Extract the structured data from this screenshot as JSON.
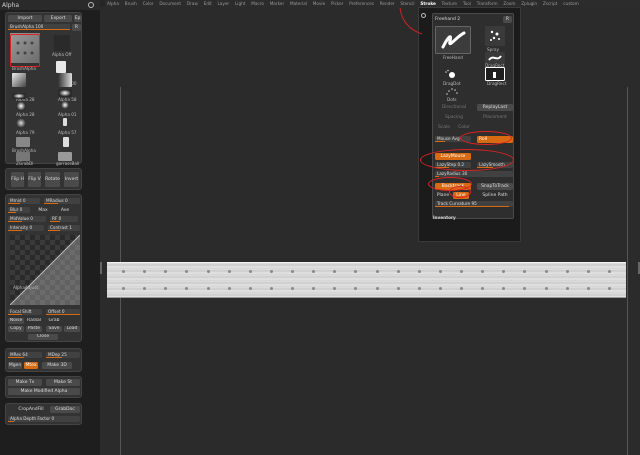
{
  "palette": {
    "title": "Alpha",
    "import_label": "Import",
    "export_label": "Export",
    "ep_label": "Ep",
    "brush_alpha_slider": "BrushAlpha 100",
    "r_label": "R",
    "current_alpha_label": "BrushAlpha",
    "alpha_off_label": "Alpha Off",
    "thumb_labels": [
      "Alpha 00",
      "Alpha 28",
      "Alpha 58",
      "Alpha 28",
      "Alpha 01",
      "Alpha 79",
      "Alpha 57",
      "BrushAlpha",
      "ZGrabDl",
      "garrassBall"
    ],
    "tool_buttons": [
      "Flip H",
      "Flip V",
      "Rotate",
      "Invert"
    ],
    "adjust": {
      "mmid_label": "Mmid 0",
      "mradius_label": "MRadius 0",
      "blur_label": "Blur 0",
      "max_label": "Max",
      "ave_label": "Ave",
      "midvalue_label": "MidValue 0",
      "rf_label": "RF 0",
      "intensity_label": "Intensity 0",
      "contrast_label": "Contrast 1",
      "alpha_adjust_label": "AlphaAdjust",
      "focal_shift_label": "Focal Shift",
      "offset_label": "Offset 0",
      "noise_label": "Noise",
      "radial_label": "Radial",
      "grab_label": "Grab",
      "copy_label": "Copy",
      "paste_label": "Paste",
      "save_label": "Save",
      "load_label": "Load",
      "close_label": "Close"
    },
    "make": {
      "mres_label": "MRes 64",
      "mdep_label": "MDep 25",
      "mgen_label": "Mgen",
      "mtex_label": "Mtex",
      "make3d_label": "Make 3D",
      "maketx_label": "Make Tx",
      "makest_label": "Make St",
      "make_modified_label": "Make Modified Alpha"
    },
    "depth": {
      "cropfill_label": "CropAndFill",
      "grabdoc_label": "GrabDoc",
      "depth_factor_label": "Alpha Depth Factor 0"
    }
  },
  "menubar": {
    "items": [
      "Alpha",
      "Brush",
      "Color",
      "Document",
      "Draw",
      "Edit",
      "Layer",
      "Light",
      "Macro",
      "Marker",
      "Material",
      "Movie",
      "Picker",
      "Preferences",
      "Render",
      "Stencil",
      "Stroke",
      "Texture",
      "Tool",
      "Transform",
      "Zoom",
      "Zplugin",
      "Zscript",
      "custom"
    ]
  },
  "stroke_popup": {
    "type_label": "Freehand 2",
    "r_label": "R",
    "freehand_label": "FreeHand",
    "spray_label": "Spray",
    "colorize_label": "DragRect",
    "dragdot_label": "DragDot",
    "dragrect_label": "DragRect",
    "dots_label": "Dots",
    "directional_label": "Directional",
    "replaylast_label": "ReplayLast",
    "spacing_label": "Spacing",
    "placement_label": "Placement",
    "scale_label": "Scale",
    "color_label": "Color",
    "mouse_avg_label": "Mouse Avg",
    "roll_label": "Roll",
    "lazymouse_label": "LazyMouse",
    "lazystep_label": "LazyStep 0.2",
    "lazysmooth_label": "LazySmooth",
    "lazyradius_label": "LazyRadius 30",
    "backtrack_label": "Backtrack",
    "snaptotrack_label": "SnapToTrack",
    "plane_label": "Plane",
    "line_label": "Line",
    "spline_path_label": "Spline Path",
    "track_curvature_label": "Track Curvature 95",
    "inventory_label": "Inventory"
  }
}
